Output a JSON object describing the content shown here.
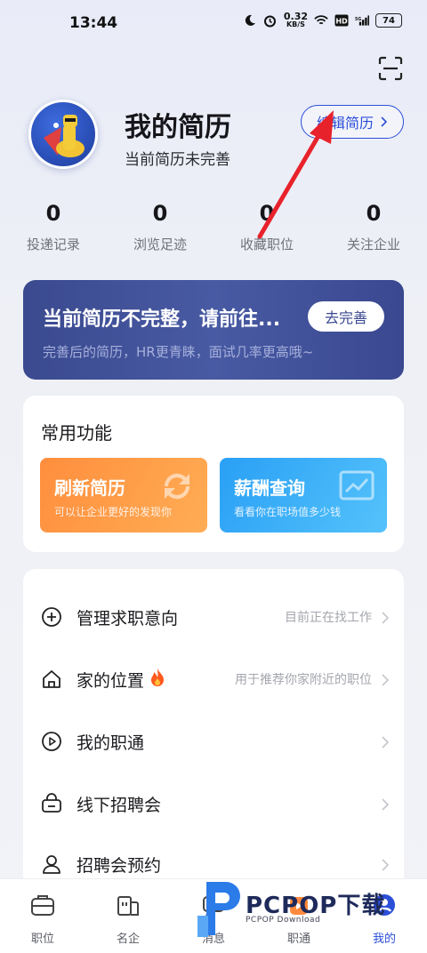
{
  "status_bar": {
    "time": "13:44",
    "net_speed_value": "0.32",
    "net_speed_unit": "KB/S",
    "battery": "74",
    "icons": [
      "moon-icon",
      "alarm-icon",
      "wifi-icon",
      "hd-icon",
      "signal-5g-icon",
      "battery-icon"
    ]
  },
  "header": {
    "title": "我的简历",
    "subtitle": "当前简历未完善",
    "edit_label": "编辑简历"
  },
  "stats": [
    {
      "value": "0",
      "label": "投递记录"
    },
    {
      "value": "0",
      "label": "浏览足迹"
    },
    {
      "value": "0",
      "label": "收藏职位"
    },
    {
      "value": "0",
      "label": "关注企业"
    }
  ],
  "banner": {
    "title": "当前简历不完整，请前往...",
    "subtitle": "完善后的简历，HR更青睐，面试几率更高哦~",
    "button": "去完善"
  },
  "functions": {
    "title": "常用功能",
    "tiles": [
      {
        "title": "刷新简历",
        "subtitle": "可以让企业更好的发现你",
        "color": "#ff8e3d"
      },
      {
        "title": "薪酬查询",
        "subtitle": "看看你在职场值多少钱",
        "color": "#2aa0f5"
      }
    ]
  },
  "list": [
    {
      "label": "管理求职意向",
      "hint": "目前正在找工作",
      "icon": "plus-circle-icon"
    },
    {
      "label": "家的位置",
      "hint": "用于推荐你家附近的职位",
      "icon": "home-icon",
      "badge": "🔥"
    },
    {
      "label": "我的职通",
      "hint": "",
      "icon": "play-circle-icon"
    },
    {
      "label": "线下招聘会",
      "hint": "",
      "icon": "bag-icon"
    },
    {
      "label": "招聘会预约",
      "hint": "",
      "icon": "person-icon"
    }
  ],
  "nav": [
    {
      "label": "职位",
      "icon": "briefcase-icon"
    },
    {
      "label": "名企",
      "icon": "building-icon"
    },
    {
      "label": "消息",
      "icon": "message-icon"
    },
    {
      "label": "职通",
      "icon": "video-icon"
    },
    {
      "label": "我的",
      "icon": "profile-icon",
      "active": true
    }
  ],
  "watermark": {
    "text": "PCPOP下载",
    "sub": "PCPOP Download"
  },
  "colors": {
    "accent": "#2c4fd8",
    "banner": "#3b4a8f",
    "arrow": "#e8222b"
  }
}
